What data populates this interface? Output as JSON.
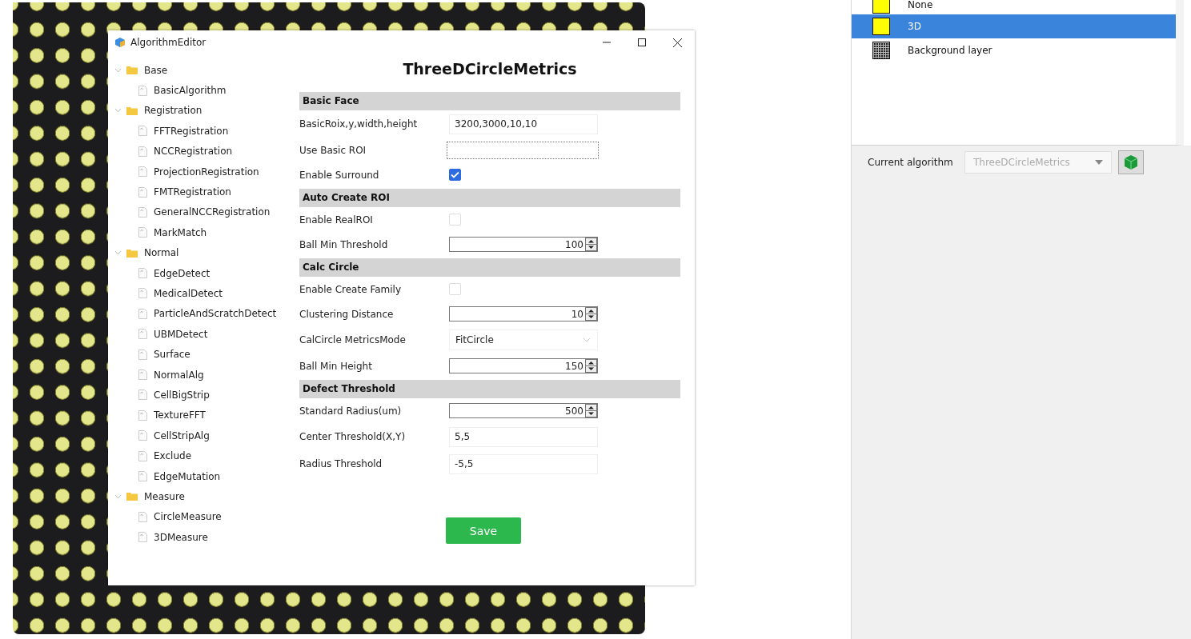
{
  "dialog": {
    "title": "AlgorithmEditor",
    "tree": [
      {
        "label": "Base",
        "expanded": true,
        "children": [
          {
            "label": "BasicAlgorithm"
          }
        ]
      },
      {
        "label": "Registration",
        "expanded": true,
        "children": [
          {
            "label": "FFTRegistration"
          },
          {
            "label": "NCCRegistration"
          },
          {
            "label": "ProjectionRegistration"
          },
          {
            "label": "FMTRegistration"
          },
          {
            "label": "GeneralNCCRegistration"
          },
          {
            "label": "MarkMatch"
          }
        ]
      },
      {
        "label": "Normal",
        "expanded": true,
        "children": [
          {
            "label": "EdgeDetect"
          },
          {
            "label": "MedicalDetect"
          },
          {
            "label": "ParticleAndScratchDetect"
          },
          {
            "label": "UBMDetect"
          },
          {
            "label": "Surface"
          },
          {
            "label": "NormalAlg"
          },
          {
            "label": "CellBigStrip"
          },
          {
            "label": "TextureFFT"
          },
          {
            "label": "CellStripAlg"
          },
          {
            "label": "Exclude"
          },
          {
            "label": "EdgeMutation"
          }
        ]
      },
      {
        "label": "Measure",
        "expanded": true,
        "children": [
          {
            "label": "CircleMeasure"
          },
          {
            "label": "3DMeasure"
          }
        ]
      }
    ],
    "heading": "ThreeDCircleMetrics",
    "sections": [
      {
        "title": "Basic Face",
        "fields": [
          {
            "kind": "text",
            "label": "BasicRoix,y,width,height",
            "value": "3200,3000,10,10"
          },
          {
            "kind": "focus",
            "label": "Use Basic ROI"
          },
          {
            "kind": "checkbox",
            "label": "Enable Surround",
            "checked": true
          }
        ]
      },
      {
        "title": "Auto Create ROI",
        "fields": [
          {
            "kind": "checkbox",
            "label": "Enable RealROI",
            "checked": false
          },
          {
            "kind": "spin",
            "label": "Ball Min Threshold",
            "value": "100"
          }
        ]
      },
      {
        "title": "Calc Circle",
        "fields": [
          {
            "kind": "checkbox",
            "label": "Enable Create Family",
            "checked": false
          },
          {
            "kind": "spin",
            "label": "Clustering Distance",
            "value": "10"
          },
          {
            "kind": "dropdown",
            "label": "CalCircle MetricsMode",
            "value": "FitCircle"
          },
          {
            "kind": "spin",
            "label": "Ball Min Height",
            "value": "150"
          }
        ]
      },
      {
        "title": "Defect Threshold",
        "fields": [
          {
            "kind": "spin",
            "label": "Standard Radius(um)",
            "value": "500"
          },
          {
            "kind": "text",
            "label": "Center Threshold(X,Y)",
            "value": "5,5"
          },
          {
            "kind": "text",
            "label": "Radius Threshold",
            "value": "-5,5"
          }
        ]
      }
    ],
    "save_button": "Save"
  },
  "layers": [
    {
      "name": "None",
      "kind": "solid",
      "color": "#ffff00",
      "selected": false
    },
    {
      "name": "3D",
      "kind": "solid",
      "color": "#ffff00",
      "selected": true
    },
    {
      "name": "Background layer",
      "kind": "pattern",
      "color": "#202020",
      "selected": false
    }
  ],
  "algorithm": {
    "label": "Current algorithm",
    "value": "ThreeDCircleMetrics",
    "disabled": true
  }
}
